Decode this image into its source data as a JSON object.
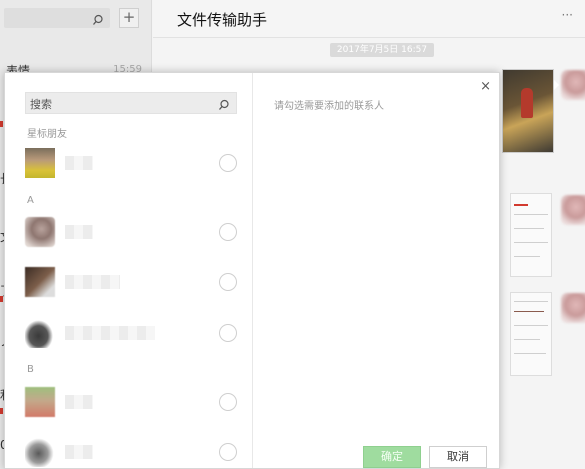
{
  "app": {
    "chat_title": "文件传输助手",
    "more": "···",
    "timestamp": "2017年7月5日 16:57",
    "add_symbol": "+"
  },
  "sidebar": {
    "items": [
      {
        "name": "表情",
        "time": "15:59"
      },
      {
        "name": "",
        "time": ""
      },
      {
        "name": "长",
        "time": ""
      },
      {
        "name": "文",
        "time": ""
      },
      {
        "name": "了",
        "time": ""
      },
      {
        "name": "ノ",
        "time": ""
      },
      {
        "name": "利",
        "time": ""
      },
      {
        "name": "0",
        "time": ""
      }
    ]
  },
  "dialog": {
    "search_placeholder": "搜索",
    "hint": "请勾选需要添加的联系人",
    "close": "×",
    "confirm_label": "确定",
    "cancel_label": "取消",
    "sections": [
      "星标朋友",
      "A",
      "B"
    ]
  },
  "icons": {
    "search": "search-icon",
    "close": "close-icon",
    "add": "plus-icon"
  },
  "colors": {
    "confirm_button": "#9fdc9f",
    "unread_dot": "#d23a2f"
  }
}
